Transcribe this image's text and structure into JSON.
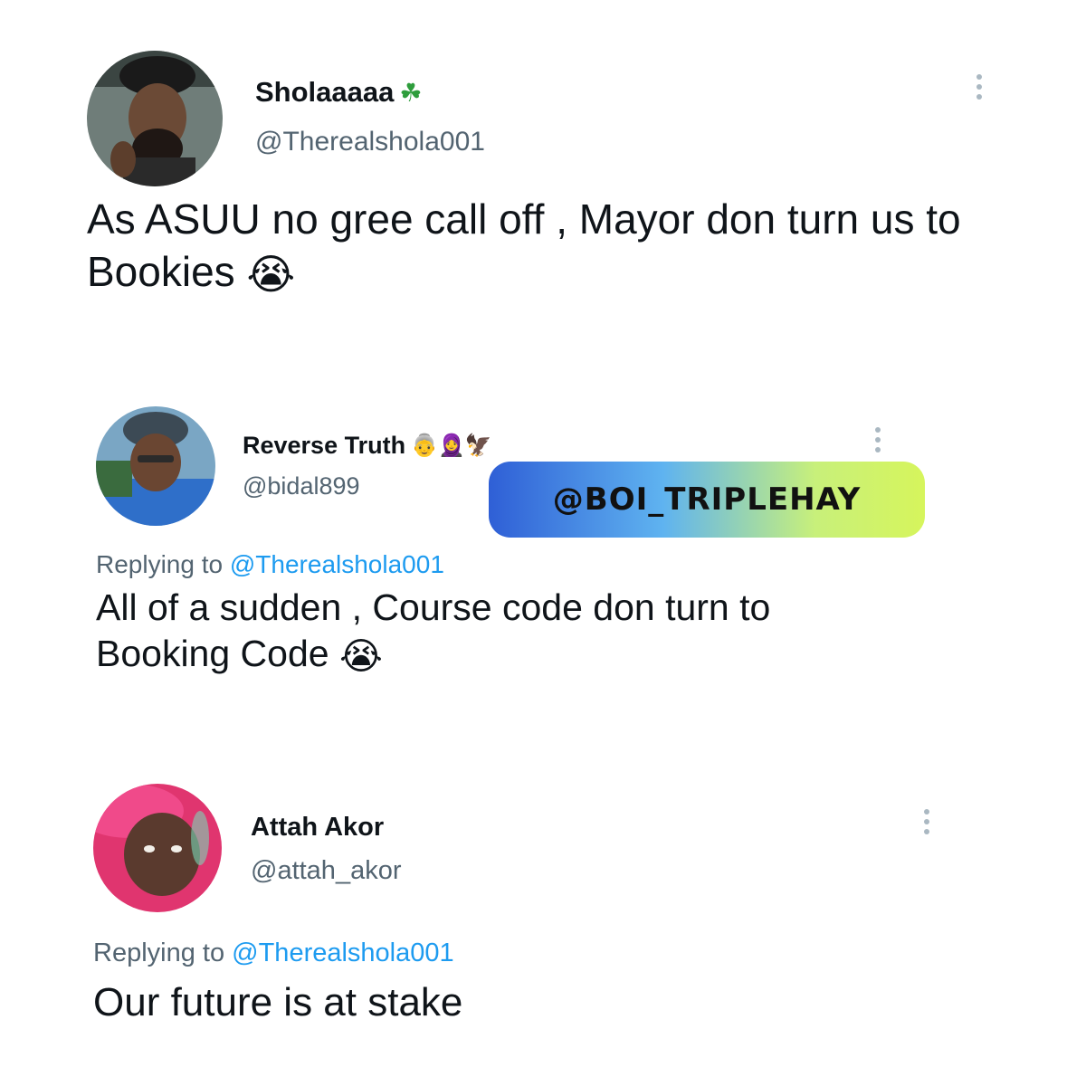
{
  "tweets": [
    {
      "display_name": "Sholaaaaa",
      "name_emoji": "☘",
      "handle": "@Therealshola001",
      "text": "As ASUU no gree call off , Mayor don turn us to Bookies",
      "text_emoji": "😭",
      "replying_prefix": "",
      "replying_to": ""
    },
    {
      "display_name": "Reverse Truth",
      "name_emoji": "👵🧕🦅",
      "handle": "@bidal899",
      "text": "All of a sudden , Course code don turn to Booking Code",
      "text_emoji": "😭",
      "replying_prefix": "Replying to",
      "replying_to": "@Therealshola001"
    },
    {
      "display_name": "Attah Akor",
      "name_emoji": "",
      "handle": "@attah_akor",
      "text": "Our future is at stake",
      "text_emoji": "",
      "replying_prefix": "Replying to",
      "replying_to": "@Therealshola001"
    }
  ],
  "watermark": "@BOI_TRIPLEHAY",
  "colors": {
    "handle_gray": "#536471",
    "link_blue": "#1d9bf0",
    "text_dark": "#0f1419"
  },
  "icons": {
    "more_options": "more-vertical-icon",
    "cry_emoji": "loudly-crying-face-icon"
  }
}
